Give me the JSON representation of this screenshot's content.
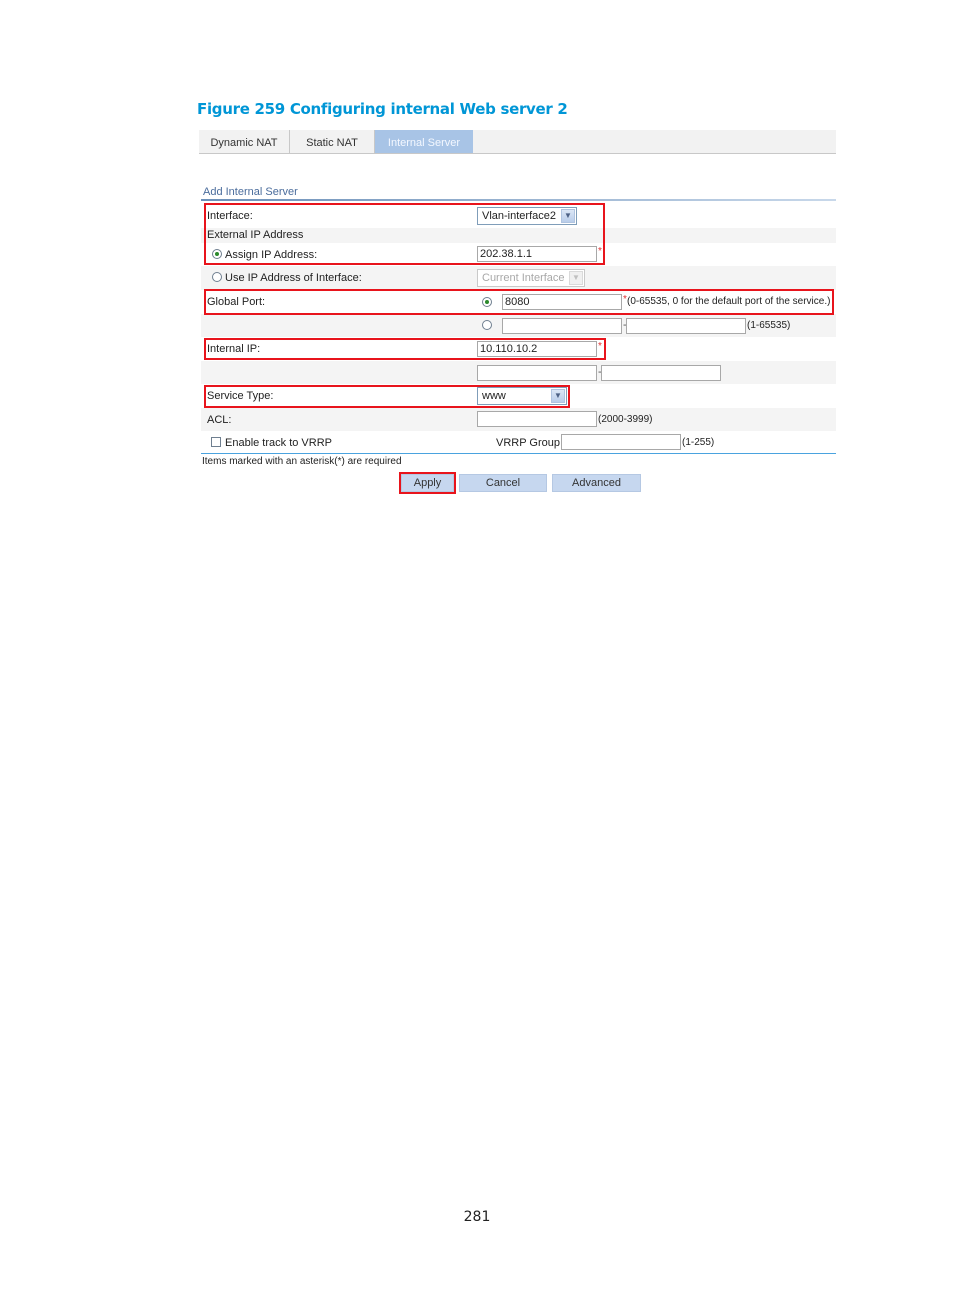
{
  "figure_title": "Figure 259 Configuring internal Web server 2",
  "tabs": [
    {
      "label": "Dynamic NAT",
      "active": false
    },
    {
      "label": "Static NAT",
      "active": false
    },
    {
      "label": "Internal Server",
      "active": true
    }
  ],
  "section_title": "Add Internal Server",
  "form": {
    "interface": {
      "label": "Interface:",
      "value": "Vlan-interface2"
    },
    "external_ip": {
      "label": "External IP Address",
      "assign": {
        "label": "Assign IP Address:",
        "selected": true,
        "value": "202.38.1.1",
        "required": "*"
      },
      "use_interface": {
        "label": "Use IP Address of Interface:",
        "selected": false,
        "value": "Current Interface"
      }
    },
    "global_port": {
      "label": "Global Port:",
      "single": {
        "selected": true,
        "value": "8080",
        "required": "*",
        "hint": "(0-65535, 0 for the default port of the service.)"
      },
      "range": {
        "selected": false,
        "start": "",
        "end": "",
        "separator": "-",
        "hint": "(1-65535)"
      }
    },
    "internal_ip": {
      "label": "Internal IP:",
      "value": "10.110.10.2",
      "required": "*",
      "range_start": "",
      "range_end": "",
      "separator": "-"
    },
    "service_type": {
      "label": "Service Type:",
      "value": "www"
    },
    "acl": {
      "label": "ACL:",
      "value": "",
      "hint": "(2000-3999)"
    },
    "vrrp": {
      "checkbox_label": "Enable track to VRRP",
      "checked": false,
      "group_label": "VRRP Group:",
      "group_value": "",
      "hint": "(1-255)"
    }
  },
  "required_note": "Items marked with an asterisk(*) are required",
  "buttons": {
    "apply": "Apply",
    "cancel": "Cancel",
    "advanced": "Advanced"
  },
  "page_number": "281",
  "colors": {
    "highlight": "#e8141c",
    "title": "#0096d6",
    "active_tab": "#a8c4e6",
    "button": "#c6d7ef"
  }
}
